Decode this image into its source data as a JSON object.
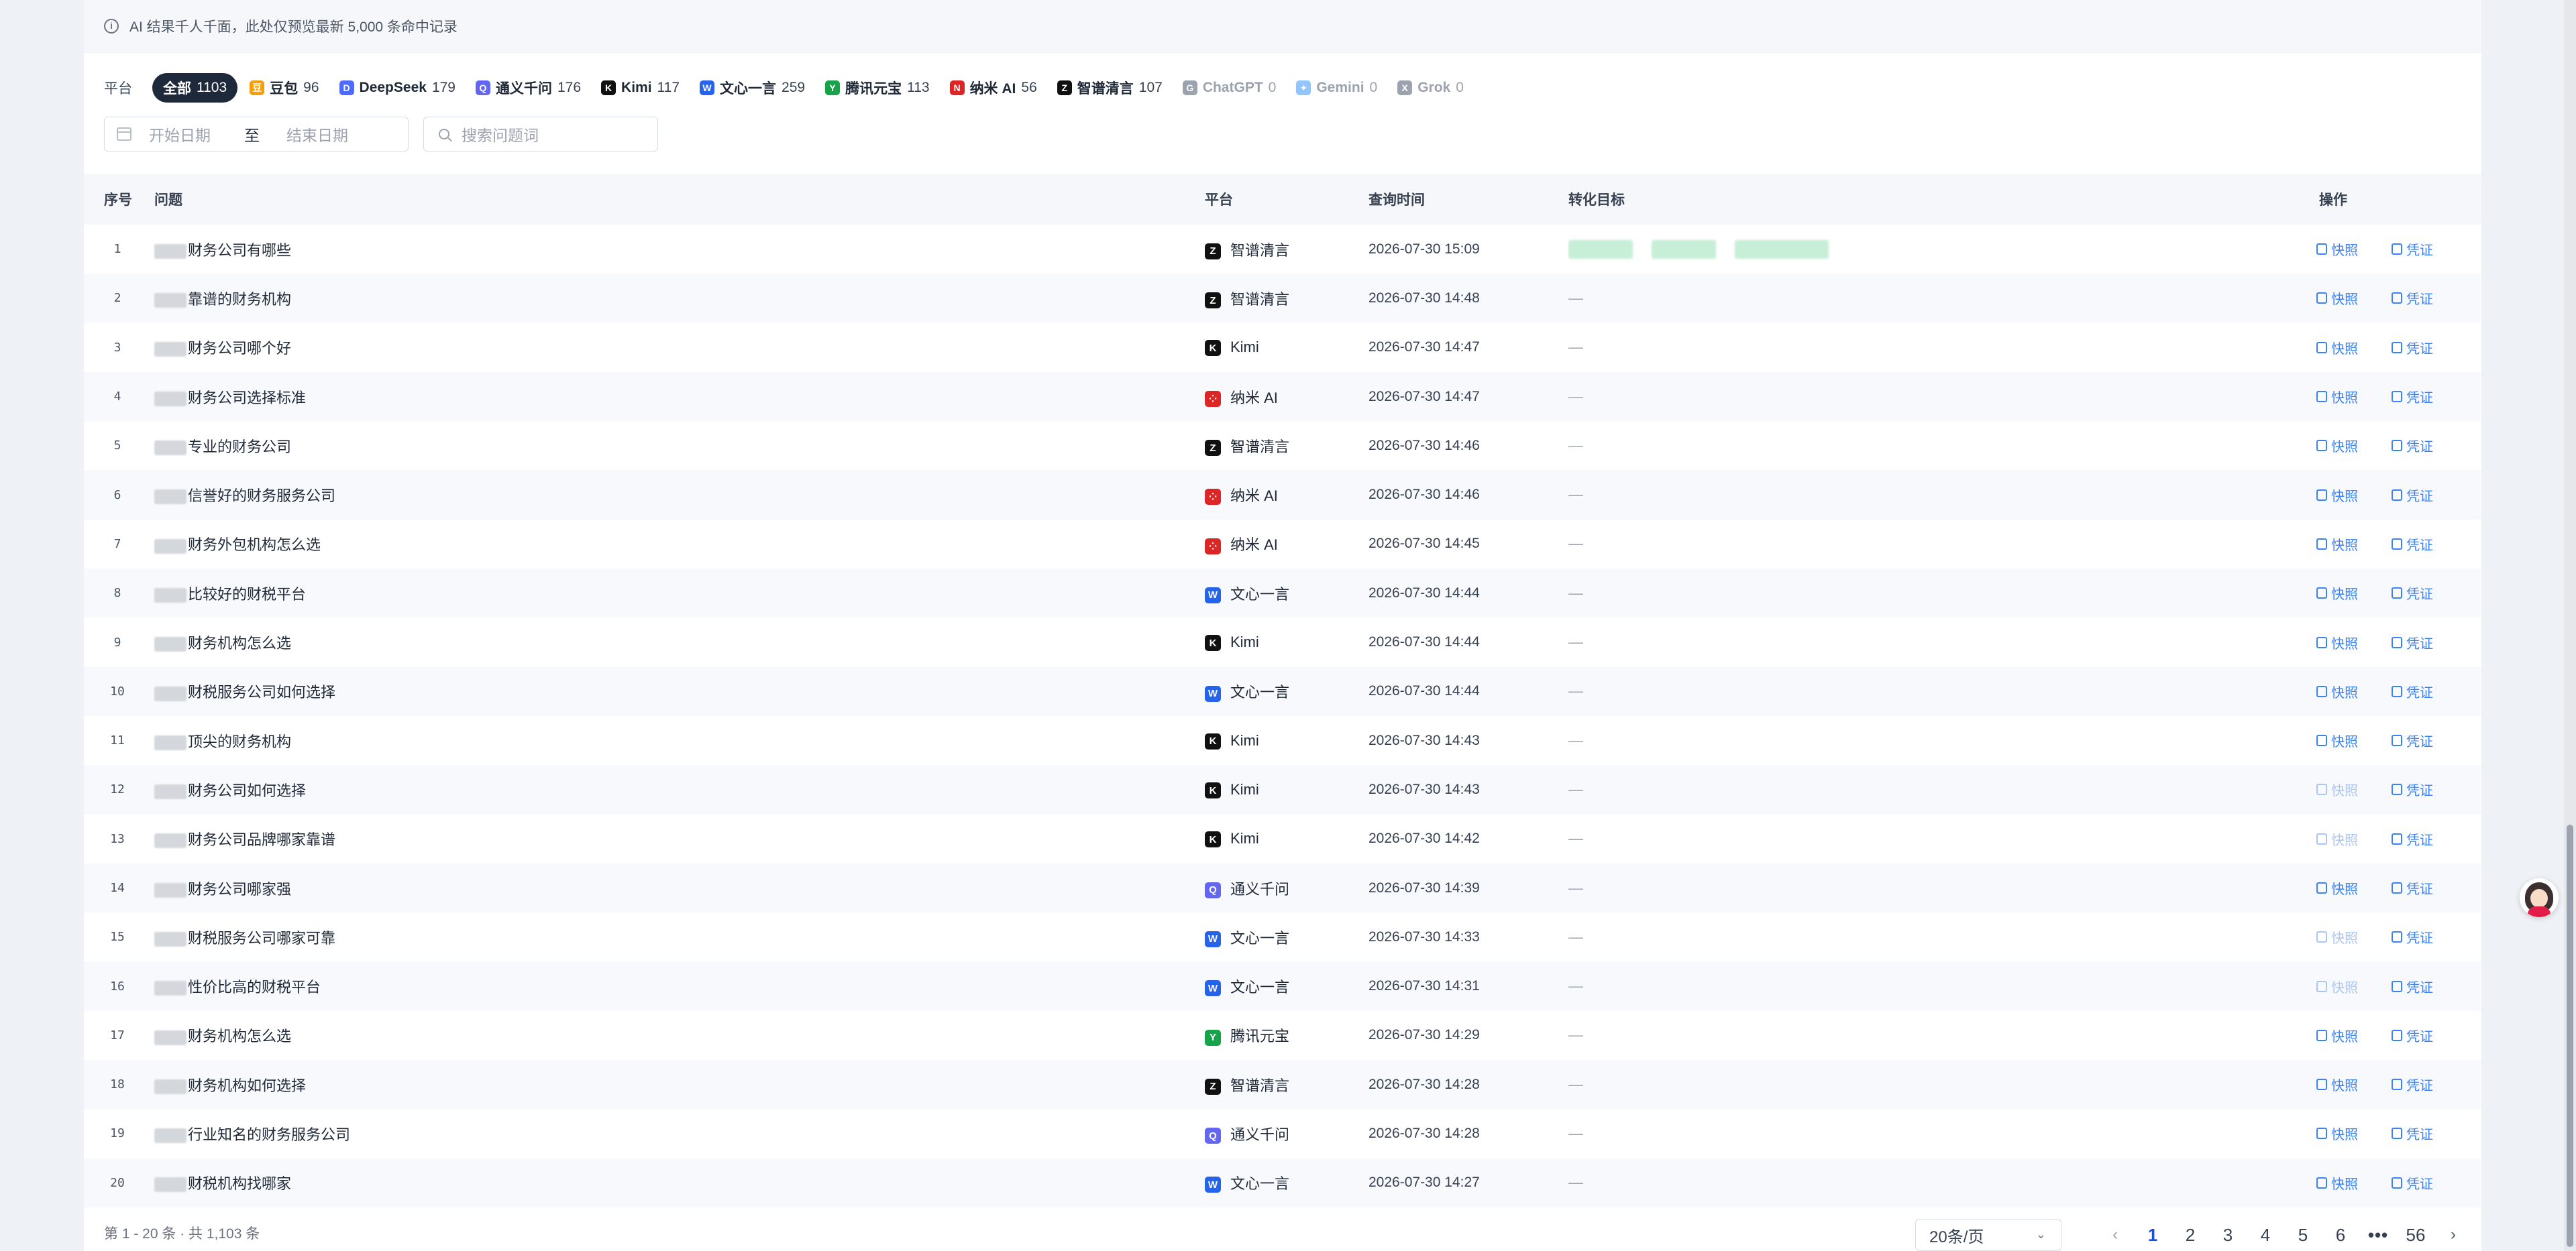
{
  "notice": "AI 结果千人千面，此处仅预览最新 5,000 条命中记录",
  "filters": {
    "platform_label": "平台",
    "chips": [
      {
        "name": "全部",
        "count": "1103",
        "active": true,
        "icon": "",
        "color": "",
        "disabled": false
      },
      {
        "name": "豆包",
        "count": "96",
        "active": false,
        "icon": "豆",
        "color": "#f59e0b",
        "disabled": false
      },
      {
        "name": "DeepSeek",
        "count": "179",
        "active": false,
        "icon": "D",
        "color": "#4d6bfe",
        "disabled": false
      },
      {
        "name": "通义千问",
        "count": "176",
        "active": false,
        "icon": "Q",
        "color": "#6366f1",
        "disabled": false
      },
      {
        "name": "Kimi",
        "count": "117",
        "active": false,
        "icon": "K",
        "color": "#111111",
        "disabled": false
      },
      {
        "name": "文心一言",
        "count": "259",
        "active": false,
        "icon": "W",
        "color": "#2563eb",
        "disabled": false
      },
      {
        "name": "腾讯元宝",
        "count": "113",
        "active": false,
        "icon": "Y",
        "color": "#16a34a",
        "disabled": false
      },
      {
        "name": "纳米 AI",
        "count": "56",
        "active": false,
        "icon": "N",
        "color": "#dc2626",
        "disabled": false
      },
      {
        "name": "智谱清言",
        "count": "107",
        "active": false,
        "icon": "Z",
        "color": "#111111",
        "disabled": false
      },
      {
        "name": "ChatGPT",
        "count": "0",
        "active": false,
        "icon": "G",
        "color": "#9ca3af",
        "disabled": true
      },
      {
        "name": "Gemini",
        "count": "0",
        "active": false,
        "icon": "✦",
        "color": "#93c5fd",
        "disabled": true
      },
      {
        "name": "Grok",
        "count": "0",
        "active": false,
        "icon": "X",
        "color": "#9ca3af",
        "disabled": true
      }
    ],
    "start_placeholder": "开始日期",
    "date_separator": "至",
    "end_placeholder": "结束日期",
    "search_placeholder": "搜索问题词"
  },
  "table": {
    "headers": {
      "index": "序号",
      "question": "问题",
      "platform": "平台",
      "time": "查询时间",
      "target": "转化目标",
      "action": "操作"
    },
    "snapshot_label": "快照",
    "proof_label": "凭证",
    "empty_target": "—",
    "platform_icons": {
      "智谱清言": {
        "letter": "Z",
        "color": "#111111"
      },
      "Kimi": {
        "letter": "K",
        "color": "#111111"
      },
      "纳米 AI": {
        "letter": "⁘",
        "color": "#dc2626"
      },
      "文心一言": {
        "letter": "W",
        "color": "#2563eb"
      },
      "通义千问": {
        "letter": "Q",
        "color": "#6366f1"
      },
      "腾讯元宝": {
        "letter": "Y",
        "color": "#16a34a"
      }
    },
    "rows": [
      {
        "idx": "1",
        "question": "财务公司有哪些",
        "platform": "智谱清言",
        "time": "2026-07-30 15:09",
        "has_target": true,
        "snap_dim": false
      },
      {
        "idx": "2",
        "question": "靠谱的财务机构",
        "platform": "智谱清言",
        "time": "2026-07-30 14:48",
        "has_target": false,
        "snap_dim": false
      },
      {
        "idx": "3",
        "question": "财务公司哪个好",
        "platform": "Kimi",
        "time": "2026-07-30 14:47",
        "has_target": false,
        "snap_dim": false
      },
      {
        "idx": "4",
        "question": "财务公司选择标准",
        "platform": "纳米 AI",
        "time": "2026-07-30 14:47",
        "has_target": false,
        "snap_dim": false
      },
      {
        "idx": "5",
        "question": "专业的财务公司",
        "platform": "智谱清言",
        "time": "2026-07-30 14:46",
        "has_target": false,
        "snap_dim": false
      },
      {
        "idx": "6",
        "question": "信誉好的财务服务公司",
        "platform": "纳米 AI",
        "time": "2026-07-30 14:46",
        "has_target": false,
        "snap_dim": false
      },
      {
        "idx": "7",
        "question": "财务外包机构怎么选",
        "platform": "纳米 AI",
        "time": "2026-07-30 14:45",
        "has_target": false,
        "snap_dim": false
      },
      {
        "idx": "8",
        "question": "比较好的财税平台",
        "platform": "文心一言",
        "time": "2026-07-30 14:44",
        "has_target": false,
        "snap_dim": false
      },
      {
        "idx": "9",
        "question": "财务机构怎么选",
        "platform": "Kimi",
        "time": "2026-07-30 14:44",
        "has_target": false,
        "snap_dim": false
      },
      {
        "idx": "10",
        "question": "财税服务公司如何选择",
        "platform": "文心一言",
        "time": "2026-07-30 14:44",
        "has_target": false,
        "snap_dim": false
      },
      {
        "idx": "11",
        "question": "顶尖的财务机构",
        "platform": "Kimi",
        "time": "2026-07-30 14:43",
        "has_target": false,
        "snap_dim": false
      },
      {
        "idx": "12",
        "question": "财务公司如何选择",
        "platform": "Kimi",
        "time": "2026-07-30 14:43",
        "has_target": false,
        "snap_dim": true
      },
      {
        "idx": "13",
        "question": "财务公司品牌哪家靠谱",
        "platform": "Kimi",
        "time": "2026-07-30 14:42",
        "has_target": false,
        "snap_dim": true
      },
      {
        "idx": "14",
        "question": "财务公司哪家强",
        "platform": "通义千问",
        "time": "2026-07-30 14:39",
        "has_target": false,
        "snap_dim": false
      },
      {
        "idx": "15",
        "question": "财税服务公司哪家可靠",
        "platform": "文心一言",
        "time": "2026-07-30 14:33",
        "has_target": false,
        "snap_dim": true
      },
      {
        "idx": "16",
        "question": "性价比高的财税平台",
        "platform": "文心一言",
        "time": "2026-07-30 14:31",
        "has_target": false,
        "snap_dim": true
      },
      {
        "idx": "17",
        "question": "财务机构怎么选",
        "platform": "腾讯元宝",
        "time": "2026-07-30 14:29",
        "has_target": false,
        "snap_dim": false
      },
      {
        "idx": "18",
        "question": "财务机构如何选择",
        "platform": "智谱清言",
        "time": "2026-07-30 14:28",
        "has_target": false,
        "snap_dim": false
      },
      {
        "idx": "19",
        "question": "行业知名的财务服务公司",
        "platform": "通义千问",
        "time": "2026-07-30 14:28",
        "has_target": false,
        "snap_dim": false
      },
      {
        "idx": "20",
        "question": "财税机构找哪家",
        "platform": "文心一言",
        "time": "2026-07-30 14:27",
        "has_target": false,
        "snap_dim": false
      }
    ]
  },
  "footer": {
    "summary": "第 1 - 20 条 · 共 1,103 条",
    "page_size": "20条/页",
    "pages": [
      "1",
      "2",
      "3",
      "4",
      "5",
      "6",
      "•••",
      "56"
    ],
    "current_page": "1",
    "prev": "‹",
    "next": "›"
  }
}
